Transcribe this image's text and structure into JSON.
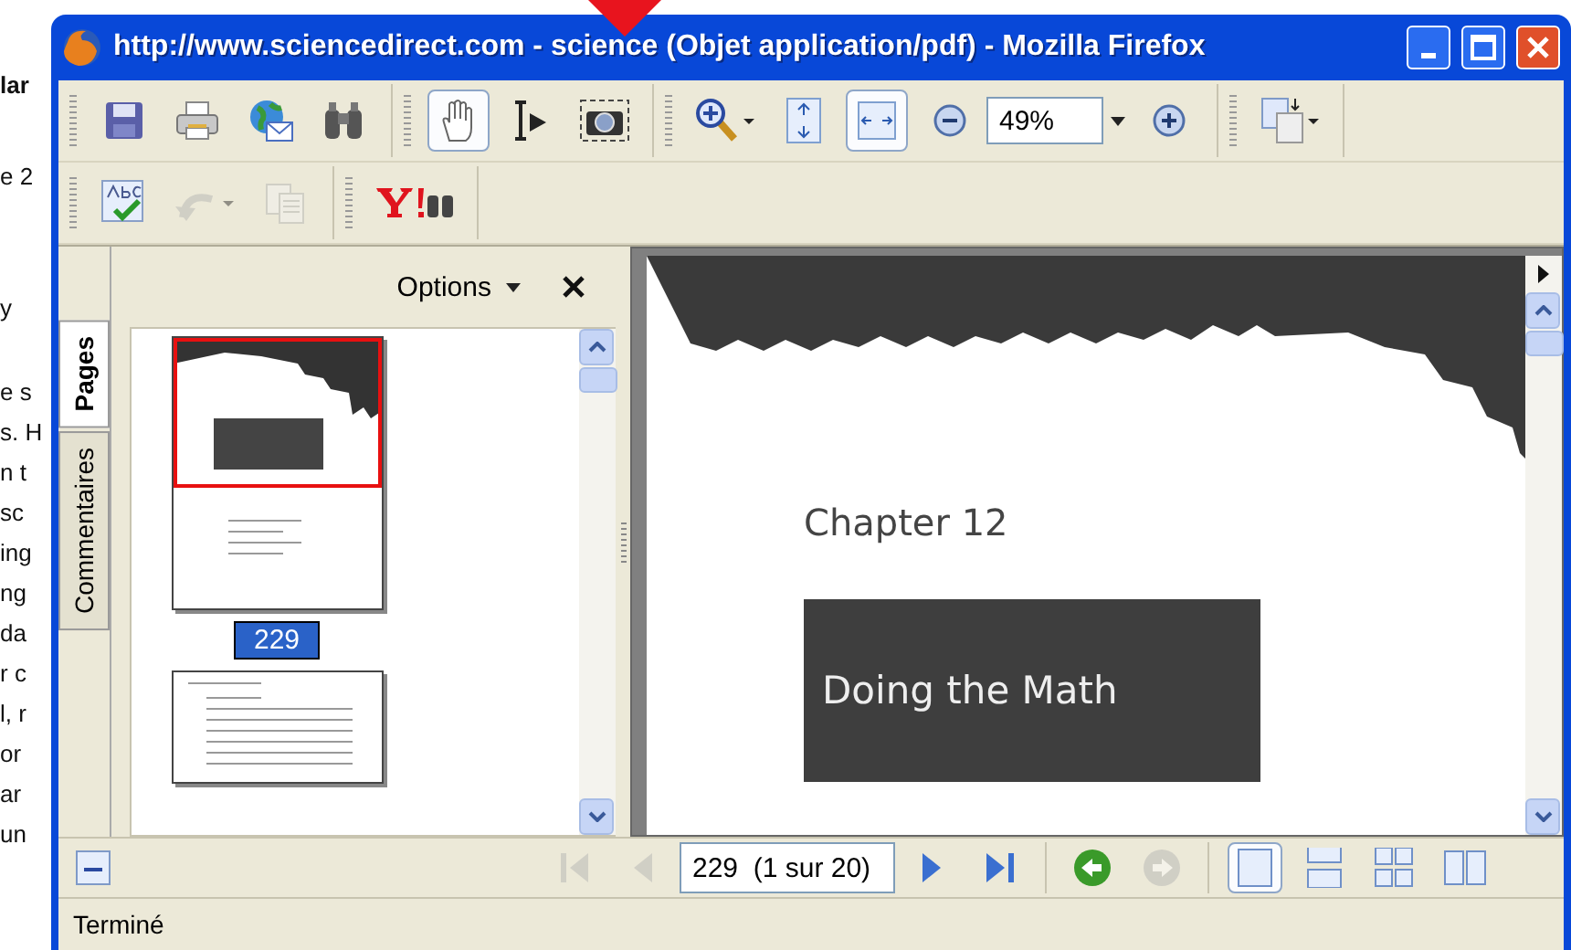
{
  "background_page": {
    "lines": [
      {
        "text": "lar",
        "bold": true
      },
      {
        "text": "e 2",
        "bold": false
      },
      {
        "text": "y",
        "bold": false
      },
      {
        "text": "e s",
        "bold": false
      },
      {
        "text": "s. H",
        "bold": false
      },
      {
        "text": "n t",
        "bold": false
      },
      {
        "text": "sc",
        "bold": false
      },
      {
        "text": "ing",
        "bold": false
      },
      {
        "text": "ng",
        "bold": false
      },
      {
        "text": "da",
        "bold": false
      },
      {
        "text": "r c",
        "bold": false
      },
      {
        "text": "l, r",
        "bold": false
      },
      {
        "text": "or",
        "bold": false
      },
      {
        "text": "ar",
        "bold": false
      },
      {
        "text": "un",
        "bold": false
      }
    ]
  },
  "window": {
    "title": "http://www.sciencedirect.com - science (Objet application/pdf) - Mozilla Firefox"
  },
  "toolbar_1": [
    {
      "kind": "save",
      "selected": false,
      "disabled": false
    },
    {
      "kind": "print",
      "selected": false,
      "disabled": false
    },
    {
      "kind": "email",
      "selected": false,
      "disabled": false
    },
    {
      "kind": "find",
      "selected": false,
      "disabled": false
    },
    {
      "kind": "sep"
    },
    {
      "kind": "hand",
      "selected": true,
      "disabled": false
    },
    {
      "kind": "select",
      "selected": false,
      "disabled": false
    },
    {
      "kind": "snapshot",
      "selected": false,
      "disabled": false
    },
    {
      "kind": "sep"
    },
    {
      "kind": "zoom",
      "selected": false,
      "disabled": false
    },
    {
      "kind": "fitpage",
      "selected": false,
      "disabled": false
    },
    {
      "kind": "fitwidth",
      "selected": true,
      "disabled": false
    },
    {
      "kind": "zoomout",
      "selected": false,
      "disabled": false
    },
    {
      "kind": "zoomfield",
      "value": "49%"
    },
    {
      "kind": "zoomin",
      "selected": false,
      "disabled": false
    },
    {
      "kind": "sep"
    },
    {
      "kind": "rotate",
      "selected": false,
      "disabled": false
    }
  ],
  "toolbar_2": [
    {
      "kind": "spell",
      "selected": false,
      "disabled": false
    },
    {
      "kind": "undo",
      "selected": false,
      "disabled": true
    },
    {
      "kind": "copy",
      "selected": false,
      "disabled": true
    },
    {
      "kind": "sep"
    },
    {
      "kind": "yahoo",
      "selected": false,
      "disabled": false
    }
  ],
  "sidebar": {
    "tabs": [
      {
        "label": "Pages",
        "selected": true
      },
      {
        "label": "Commentaires",
        "selected": false
      }
    ],
    "options": "Options",
    "thumbnails": [
      {
        "label": "229",
        "selected": true
      },
      {
        "selected": false
      }
    ]
  },
  "document": {
    "heading": "Chapter 12",
    "title": "Doing the Math"
  },
  "navigation": [
    {
      "kind": "collapse",
      "disabled": false
    },
    {
      "kind": "first",
      "disabled": true
    },
    {
      "kind": "prev",
      "disabled": true
    },
    {
      "kind": "pagefield",
      "value": "229  (1 sur 20)"
    },
    {
      "kind": "next",
      "disabled": false
    },
    {
      "kind": "last",
      "disabled": false
    },
    {
      "kind": "sep"
    },
    {
      "kind": "back",
      "disabled": false
    },
    {
      "kind": "forward",
      "disabled": true
    },
    {
      "kind": "sep"
    },
    {
      "kind": "single",
      "selected": true
    },
    {
      "kind": "continuous",
      "selected": false
    },
    {
      "kind": "contfacing",
      "selected": false
    },
    {
      "kind": "facing",
      "selected": false
    }
  ],
  "status_bar": {
    "text": "Terminé"
  }
}
